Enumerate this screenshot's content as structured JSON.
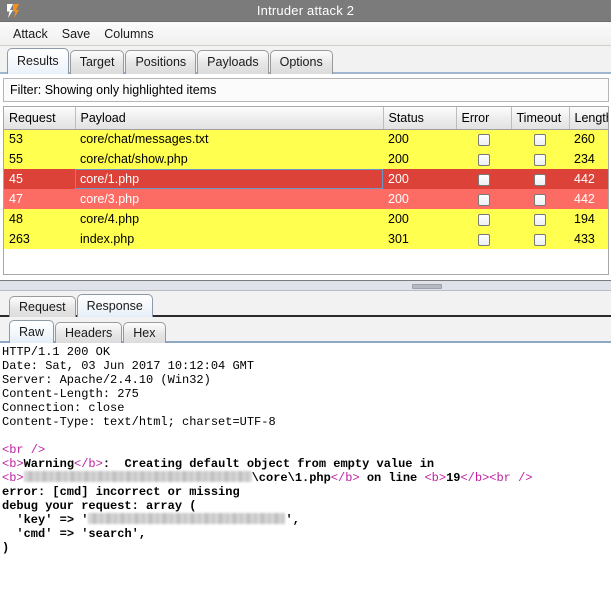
{
  "window": {
    "title": "Intruder attack 2",
    "icon": "burp-lightning-icon"
  },
  "menubar": {
    "items": [
      {
        "label": "Attack"
      },
      {
        "label": "Save"
      },
      {
        "label": "Columns"
      }
    ]
  },
  "main_tabs": {
    "active": "Results",
    "items": [
      {
        "label": "Results"
      },
      {
        "label": "Target"
      },
      {
        "label": "Positions"
      },
      {
        "label": "Payloads"
      },
      {
        "label": "Options"
      }
    ]
  },
  "filter": {
    "label": "Filter:",
    "text": "Showing only highlighted items",
    "full": "Filter: Showing only highlighted items"
  },
  "results_table": {
    "columns": [
      "Request",
      "Payload",
      "Status",
      "Error",
      "Timeout",
      "Length"
    ],
    "rows": [
      {
        "request": "53",
        "payload": "core/chat/messages.txt",
        "status": "200",
        "error": false,
        "timeout": false,
        "length": "260",
        "highlight": "yellow",
        "selected": false
      },
      {
        "request": "55",
        "payload": "core/chat/show.php",
        "status": "200",
        "error": false,
        "timeout": false,
        "length": "234",
        "highlight": "yellow",
        "selected": false
      },
      {
        "request": "45",
        "payload": "core/1.php",
        "status": "200",
        "error": false,
        "timeout": false,
        "length": "442",
        "highlight": "red",
        "selected": true
      },
      {
        "request": "47",
        "payload": "core/3.php",
        "status": "200",
        "error": false,
        "timeout": false,
        "length": "442",
        "highlight": "red",
        "selected": false
      },
      {
        "request": "48",
        "payload": "core/4.php",
        "status": "200",
        "error": false,
        "timeout": false,
        "length": "194",
        "highlight": "yellow",
        "selected": false
      },
      {
        "request": "263",
        "payload": "index.php",
        "status": "301",
        "error": false,
        "timeout": false,
        "length": "433",
        "highlight": "yellow",
        "selected": false
      }
    ]
  },
  "message_tabs": {
    "active": "Response",
    "items": [
      {
        "label": "Request"
      },
      {
        "label": "Response"
      }
    ]
  },
  "view_tabs": {
    "active": "Raw",
    "items": [
      {
        "label": "Raw"
      },
      {
        "label": "Headers"
      },
      {
        "label": "Hex"
      }
    ]
  },
  "response": {
    "lines": [
      "HTTP/1.1 200 OK",
      "Date: Sat, 03 Jun 2017 10:12:04 GMT",
      "Server: Apache/2.4.10 (Win32)",
      "Content-Length: 275",
      "Connection: close",
      "Content-Type: text/html; charset=UTF-8"
    ],
    "body": {
      "br_line": "<br />",
      "warning_prefix_tag": "<b>",
      "warning_word": "Warning",
      "warning_close_tag": "</b>",
      "warning_text": ":  Creating default object from empty value in",
      "path_open_tag": "<b>",
      "path_visible": "\\core\\1.php",
      "path_close_tag": "</b>",
      "on_line_text": " on line ",
      "line_open_tag": "<b>",
      "line_number": "19",
      "line_close_tag": "</b>",
      "trailing_br": "<br />",
      "error_line": "error: [cmd] incorrect or missing",
      "debug_line": "debug your request: array (",
      "key_label": "'key'",
      "key_arrow": "=>",
      "cmd_label": "'cmd'",
      "cmd_arrow": "=>",
      "cmd_value": "'search',",
      "close_paren": ")"
    }
  },
  "colors": {
    "highlight_yellow": "#ffff4f",
    "highlight_red": "#fc6c64",
    "highlight_red_selected": "#dc4238",
    "titlebar": "#7b7b7b",
    "accent_orange": "#f3901d",
    "tag_magenta": "#c020a0"
  }
}
